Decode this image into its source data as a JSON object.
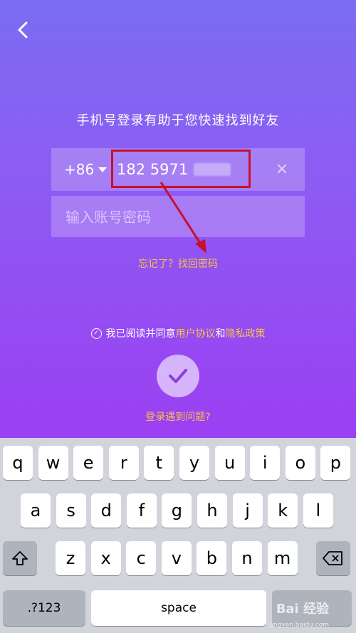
{
  "header": {
    "back_icon": "chevron-left-icon",
    "headline": "手机号登录有助于您快速找到好友"
  },
  "phone": {
    "country_code": "+86",
    "number": "182 5971",
    "clear_icon": "close-icon"
  },
  "password": {
    "placeholder": "输入账号密码"
  },
  "links": {
    "forgot": "忘记了？找回密码",
    "trouble": "登录遇到问题?"
  },
  "agreement": {
    "prefix": "我已阅读并同意",
    "terms": "用户协议",
    "and": "和",
    "privacy": "隐私政策"
  },
  "colors": {
    "accent": "#f6c24a",
    "annotation": "#c8102e"
  },
  "keyboard": {
    "row1": [
      "q",
      "w",
      "e",
      "r",
      "t",
      "y",
      "u",
      "i",
      "o",
      "p"
    ],
    "row2": [
      "a",
      "s",
      "d",
      "f",
      "g",
      "h",
      "j",
      "k",
      "l"
    ],
    "row3": [
      "z",
      "x",
      "c",
      "v",
      "b",
      "n",
      "m"
    ],
    "mode_key": ".?123",
    "space_key": "space"
  },
  "watermark": {
    "brand": "Bai 经验",
    "url": "jingyan.baidu.com"
  }
}
